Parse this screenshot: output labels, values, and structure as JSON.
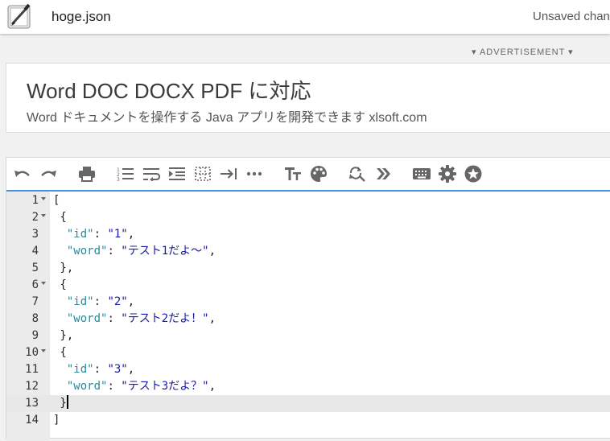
{
  "header": {
    "file_name": "hoge.json",
    "save_status": "Unsaved changes",
    "logo_icon": "pen-tablet-icon"
  },
  "ad": {
    "label": "▾ ADVERTISEMENT ▾",
    "title": "Word DOC DOCX PDF に対応",
    "subtitle": "Word ドキュメントを操作する Java アプリを開発できます xlsoft.com"
  },
  "toolbar": {
    "buttons": [
      "undo-icon",
      "redo-icon",
      "print-icon",
      "numbered-list-icon",
      "wrap-icon",
      "indent-icon",
      "grid-icon",
      "tab-icon",
      "more-icon",
      "text-size-icon",
      "palette-icon",
      "find-replace-icon",
      "chevrons-icon",
      "keyboard-icon",
      "settings-icon",
      "star-icon"
    ],
    "accent": "#4a90e2"
  },
  "editor": {
    "active_line": 13,
    "lines": [
      {
        "no": "1",
        "fold": true,
        "text": "["
      },
      {
        "no": "2",
        "fold": true,
        "text": " {"
      },
      {
        "no": "3",
        "fold": false,
        "indent": "  ",
        "key": "\"id\"",
        "sep": ": ",
        "value": "\"1\"",
        "end": ","
      },
      {
        "no": "4",
        "fold": false,
        "indent": "  ",
        "key": "\"word\"",
        "sep": ": ",
        "value": "\"テスト1だよ～\"",
        "end": ","
      },
      {
        "no": "5",
        "fold": false,
        "text": " },"
      },
      {
        "no": "6",
        "fold": true,
        "text": " {"
      },
      {
        "no": "7",
        "fold": false,
        "indent": "  ",
        "key": "\"id\"",
        "sep": ": ",
        "value": "\"2\"",
        "end": ","
      },
      {
        "no": "8",
        "fold": false,
        "indent": "  ",
        "key": "\"word\"",
        "sep": ": ",
        "value": "\"テスト2だよ！\"",
        "end": ","
      },
      {
        "no": "9",
        "fold": false,
        "text": " },"
      },
      {
        "no": "10",
        "fold": true,
        "text": " {"
      },
      {
        "no": "11",
        "fold": false,
        "indent": "  ",
        "key": "\"id\"",
        "sep": ": ",
        "value": "\"3\"",
        "end": ","
      },
      {
        "no": "12",
        "fold": false,
        "indent": "  ",
        "key": "\"word\"",
        "sep": ": ",
        "value": "\"テスト3だよ？\"",
        "end": ","
      },
      {
        "no": "13",
        "fold": false,
        "text": " }"
      },
      {
        "no": "14",
        "fold": false,
        "text": "]"
      }
    ]
  }
}
